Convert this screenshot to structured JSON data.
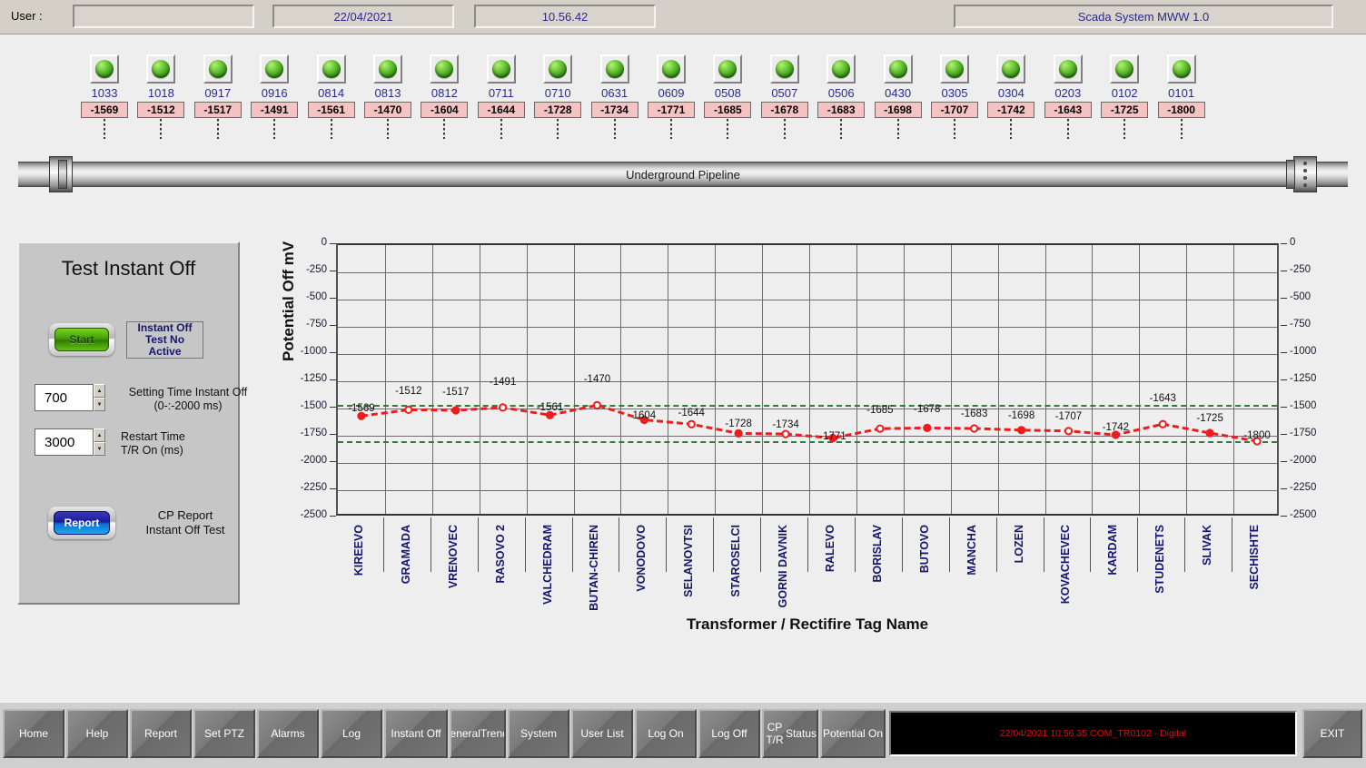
{
  "header": {
    "user_label": "User :",
    "user_value": "",
    "date": "22/04/2021",
    "time": "10.56.42",
    "system": "Scada System MWW 1.0"
  },
  "pipeline": {
    "label": "Underground Pipeline",
    "stations": [
      {
        "tag": "1033",
        "value": "-1569",
        "led": "green-led-icon"
      },
      {
        "tag": "1018",
        "value": "-1512",
        "led": "green-led-icon"
      },
      {
        "tag": "0917",
        "value": "-1517",
        "led": "green-led-icon"
      },
      {
        "tag": "0916",
        "value": "-1491",
        "led": "green-led-icon"
      },
      {
        "tag": "0814",
        "value": "-1561",
        "led": "green-led-icon"
      },
      {
        "tag": "0813",
        "value": "-1470",
        "led": "green-led-icon"
      },
      {
        "tag": "0812",
        "value": "-1604",
        "led": "green-led-icon"
      },
      {
        "tag": "0711",
        "value": "-1644",
        "led": "green-led-icon"
      },
      {
        "tag": "0710",
        "value": "-1728",
        "led": "green-led-icon"
      },
      {
        "tag": "0631",
        "value": "-1734",
        "led": "green-led-icon"
      },
      {
        "tag": "0609",
        "value": "-1771",
        "led": "green-led-icon"
      },
      {
        "tag": "0508",
        "value": "-1685",
        "led": "green-led-icon"
      },
      {
        "tag": "0507",
        "value": "-1678",
        "led": "green-led-icon"
      },
      {
        "tag": "0506",
        "value": "-1683",
        "led": "green-led-icon"
      },
      {
        "tag": "0430",
        "value": "-1698",
        "led": "green-led-icon"
      },
      {
        "tag": "0305",
        "value": "-1707",
        "led": "green-led-icon"
      },
      {
        "tag": "0304",
        "value": "-1742",
        "led": "green-led-icon"
      },
      {
        "tag": "0203",
        "value": "-1643",
        "led": "green-led-icon"
      },
      {
        "tag": "0102",
        "value": "-1725",
        "led": "green-led-icon"
      },
      {
        "tag": "0101",
        "value": "-1800",
        "led": "green-led-icon"
      }
    ]
  },
  "panel": {
    "title": "Test Instant Off",
    "start_button": "Start",
    "status_text": "Instant Off\nTest  No\nActive",
    "setting_time_value": "700",
    "setting_time_label": "Setting Time Instant Off\n(0-:-2000 ms)",
    "restart_time_value": "3000",
    "restart_time_label": "Restart Time\nT/R On (ms)",
    "report_button": "Report",
    "report_label": "CP Report\nInstant Off Test"
  },
  "chart_data": {
    "type": "line",
    "title": "",
    "xlabel": "Transformer / Rectifire Tag Name",
    "ylabel": "Potential Off mV",
    "ylim": [
      -2500,
      0
    ],
    "yticks": [
      0,
      -250,
      -500,
      -750,
      -1000,
      -1250,
      -1500,
      -1750,
      -2000,
      -2250,
      -2500
    ],
    "ytick_labels": [
      "0",
      "-250",
      "-500",
      "-750",
      "-1000",
      "-1250",
      "-1500",
      "-1750",
      "-2000",
      "-2250",
      "-2500"
    ],
    "grid": true,
    "legend": "none",
    "limit_lines": [
      {
        "value": -1470,
        "color": "#2f7d34",
        "style": "dashed"
      },
      {
        "value": -1800,
        "color": "#2f7d34",
        "style": "dashed"
      }
    ],
    "series": [
      {
        "name": "Potential Off",
        "color": "#ee1c1c",
        "style": "dashed",
        "marker": "circle",
        "values": [
          -1569,
          -1512,
          -1517,
          -1491,
          -1561,
          -1470,
          -1604,
          -1644,
          -1728,
          -1734,
          -1771,
          -1685,
          -1678,
          -1683,
          -1698,
          -1707,
          -1742,
          -1643,
          -1725,
          -1800
        ]
      }
    ],
    "categories": [
      "KIREEVO",
      "GRAMADA",
      "VRENOVEC",
      "RASOVO 2",
      "VALCHEDRAM",
      "BUTAN-CHIREN",
      "VONODOVO",
      "SELANOVTSI",
      "STAROSELCI",
      "GORNI DAVNIK",
      "RALEVO",
      "BORISLAV",
      "BUTOVO",
      "MANCHA",
      "LOZEN",
      "KOVACHEVEC",
      "KARDAM",
      "STUDENETS",
      "SLIVAK",
      "SECHISHTE"
    ],
    "data_labels": [
      "-1569",
      "-1512",
      "-1517",
      "-1491",
      "-1561",
      "-1470",
      "1604",
      "-1644",
      "-1728",
      "-1734",
      "-1771",
      "-1685",
      "-1678",
      "-1683",
      "-1698",
      "-1707",
      "-1742",
      "-1643",
      "-1725",
      "-1800"
    ]
  },
  "toolbar": {
    "buttons": [
      "Home",
      "Help",
      "Report",
      "Set PTZ",
      "Alarms",
      "Log",
      "Instant Off",
      "General\nTrends",
      "System",
      "User List",
      "Log On",
      "Log Off",
      "CP T/R\nStatus",
      "Potential On"
    ],
    "status_message": "22/04/2021 10.56.35 COM_TR0102 - Digital",
    "exit_button": "EXIT"
  }
}
